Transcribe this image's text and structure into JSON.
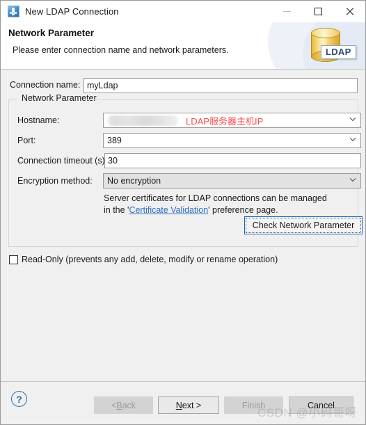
{
  "window": {
    "title": "New LDAP Connection",
    "icon": "ldap-app-icon",
    "controls": {
      "minimize": "minimize-icon",
      "maximize": "maximize-icon",
      "close": "close-icon"
    }
  },
  "header": {
    "title": "Network Parameter",
    "subtitle": "Please enter connection name and network parameters.",
    "logo_label": "LDAP"
  },
  "form": {
    "connection_name_label": "Connection name:",
    "connection_name_value": "myLdap",
    "group_title": "Network Parameter",
    "hostname_label": "Hostname:",
    "hostname_value": "",
    "hostname_annotation": "LDAP服务器主机IP",
    "hostname_annotation_color": "#fb4a4a",
    "port_label": "Port:",
    "port_value": "389",
    "timeout_label": "Connection timeout (s):",
    "timeout_value": "30",
    "encryption_label": "Encryption method:",
    "encryption_value": "No encryption",
    "cert_text_before": "Server certificates for LDAP connections can be managed in the '",
    "cert_link": "Certificate Validation",
    "cert_text_after": "' preference page.",
    "check_button": "Check Network Parameter",
    "readonly_label": "Read-Only (prevents any add, delete, modify or rename operation)",
    "readonly_checked": false
  },
  "footer": {
    "help": "?",
    "back": "< Back",
    "next_prefix": "N",
    "next_suffix": "ext >",
    "back_prefix": "< ",
    "back_mnemonic": "B",
    "back_suffix": "ack",
    "finish": "Finish",
    "cancel": "Cancel"
  },
  "watermark": "CSDN @小码哥呀"
}
